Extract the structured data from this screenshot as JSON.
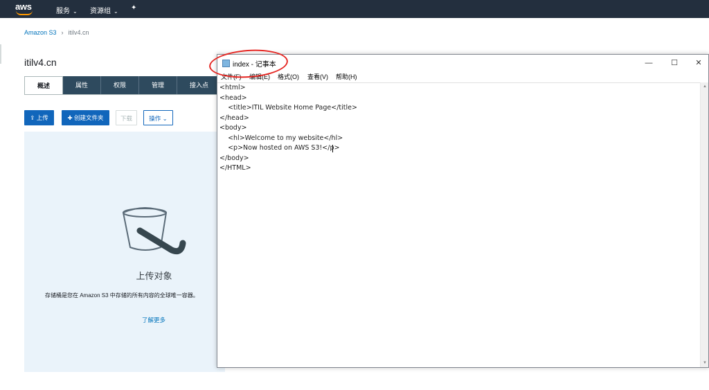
{
  "topnav": {
    "logo": "aws",
    "services": "服务",
    "resource_groups": "资源组",
    "pin_icon": "pin-icon"
  },
  "breadcrumb": {
    "root": "Amazon S3",
    "separator": "›",
    "current": "itilv4.cn"
  },
  "bucket": {
    "title": "itilv4.cn"
  },
  "tabs": [
    {
      "label": "概述",
      "active": true
    },
    {
      "label": "属性"
    },
    {
      "label": "权限"
    },
    {
      "label": "管理"
    },
    {
      "label": "接入点"
    }
  ],
  "toolbar": {
    "upload": "上传",
    "create_folder": "创建文件夹",
    "download": "下载",
    "actions": "操作"
  },
  "upload_panel": {
    "title": "上传对象",
    "description": "存储桶是您在 Amazon S3 中存储的所有内容的全球唯一容器。",
    "learn_more": "了解更多"
  },
  "notepad": {
    "title": "index - 记事本",
    "menu": [
      "文件(F)",
      "编辑(E)",
      "格式(O)",
      "查看(V)",
      "帮助(H)"
    ],
    "controls": {
      "minimize": "—",
      "maximize": "☐",
      "close": "✕"
    },
    "lines": [
      "<html>",
      "<head>",
      "    <title>ITIL Website Home Page</title>",
      "</head>",
      "<body>",
      "    <hl>Welcome to my website</hl>",
      "    <p>Now hosted on AWS S3!</p>",
      "</body>",
      "</HTML>"
    ]
  },
  "colors": {
    "nav_bg": "#232f3e",
    "aws_orange": "#ff9900",
    "primary_blue": "#1166bb",
    "tab_bg": "#2e4a5e",
    "panel_bg": "#eaf3fa",
    "highlight_red": "#e52521"
  }
}
